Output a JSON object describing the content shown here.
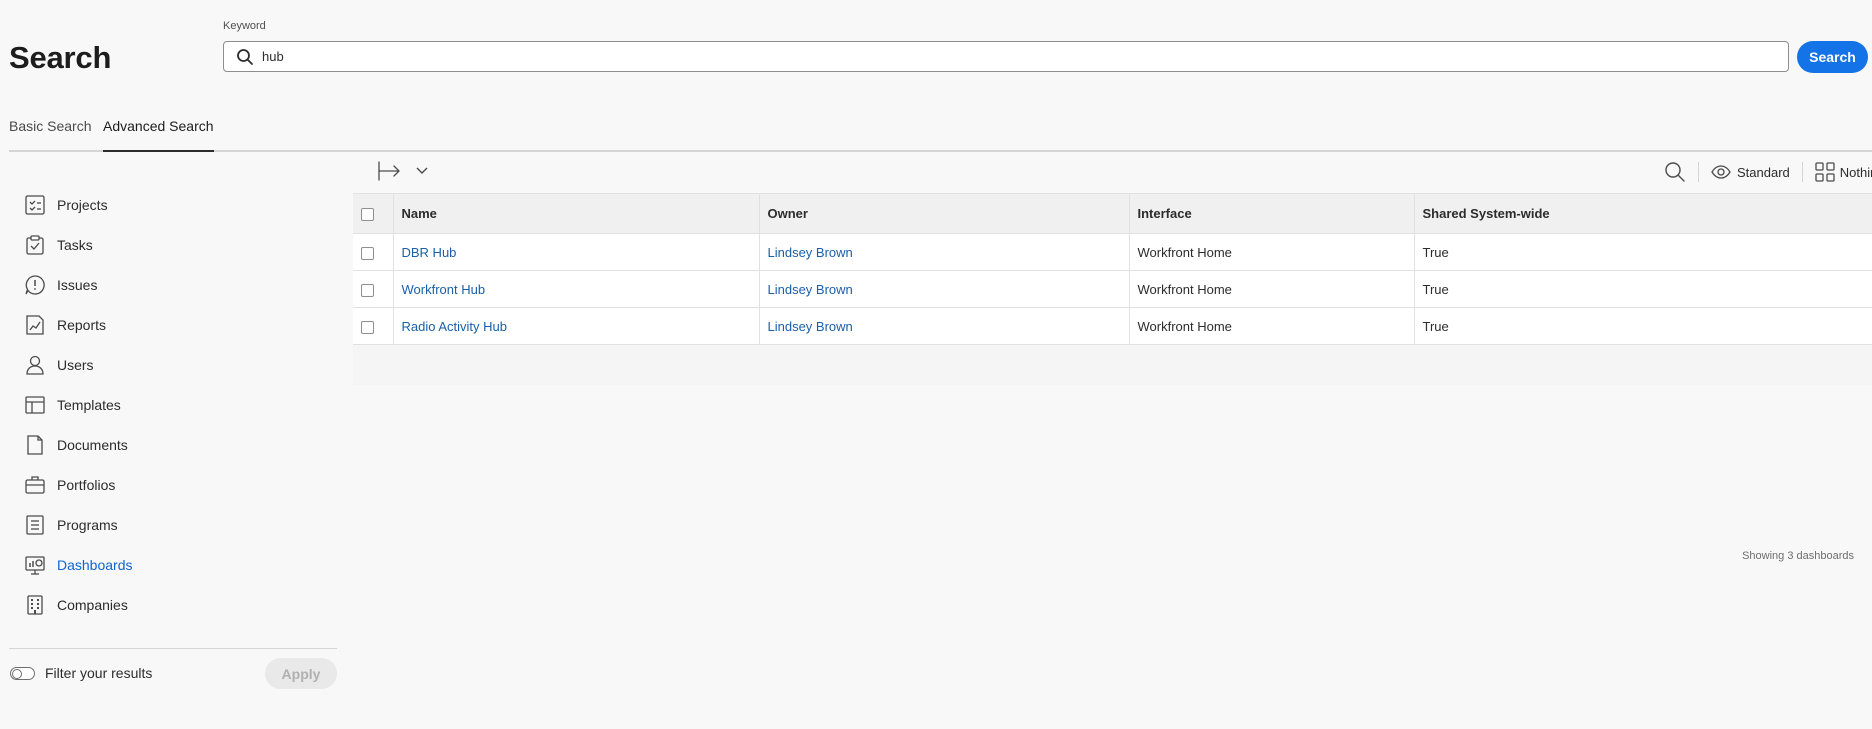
{
  "header": {
    "title": "Search",
    "keyword_label": "Keyword",
    "search_value": "hub",
    "search_button": "Search"
  },
  "tabs": [
    {
      "label": "Basic Search",
      "active": false
    },
    {
      "label": "Advanced Search",
      "active": true
    }
  ],
  "sidebar": {
    "items": [
      {
        "label": "Projects",
        "icon": "projects-icon"
      },
      {
        "label": "Tasks",
        "icon": "tasks-icon"
      },
      {
        "label": "Issues",
        "icon": "issues-icon"
      },
      {
        "label": "Reports",
        "icon": "reports-icon"
      },
      {
        "label": "Users",
        "icon": "users-icon"
      },
      {
        "label": "Templates",
        "icon": "templates-icon"
      },
      {
        "label": "Documents",
        "icon": "documents-icon"
      },
      {
        "label": "Portfolios",
        "icon": "portfolios-icon"
      },
      {
        "label": "Programs",
        "icon": "programs-icon"
      },
      {
        "label": "Dashboards",
        "icon": "dashboards-icon",
        "active": true
      },
      {
        "label": "Companies",
        "icon": "companies-icon"
      }
    ],
    "filter_label": "Filter your results",
    "apply_label": "Apply"
  },
  "toolbar": {
    "view_label": "Standard",
    "grouping_label": "Nothing"
  },
  "table": {
    "columns": [
      "Name",
      "Owner",
      "Interface",
      "Shared System-wide"
    ],
    "rows": [
      {
        "name": "DBR Hub",
        "owner": "Lindsey Brown",
        "interface": "Workfront Home",
        "shared": "True"
      },
      {
        "name": "Workfront Hub",
        "owner": "Lindsey Brown",
        "interface": "Workfront Home",
        "shared": "True"
      },
      {
        "name": "Radio Activity Hub",
        "owner": "Lindsey Brown",
        "interface": "Workfront Home",
        "shared": "True"
      }
    ],
    "footer": "Showing 3 dashboards"
  },
  "colors": {
    "accent": "#1473e6",
    "link": "#1a5fa8",
    "active_nav": "#0d66d0"
  }
}
